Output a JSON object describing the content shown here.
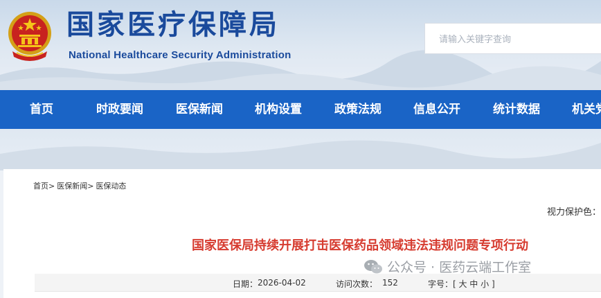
{
  "site": {
    "name_cn": "国家医疗保障局",
    "name_en": "National Healthcare Security Administration",
    "emblem_icon": "national-emblem-icon"
  },
  "search": {
    "placeholder": "请输入关键字查询"
  },
  "nav": {
    "items": [
      {
        "label": "首页"
      },
      {
        "label": "时政要闻"
      },
      {
        "label": "医保新闻"
      },
      {
        "label": "机构设置"
      },
      {
        "label": "政策法规"
      },
      {
        "label": "信息公开"
      },
      {
        "label": "统计数据"
      },
      {
        "label": "机关党"
      }
    ]
  },
  "breadcrumb": {
    "items": [
      "首页>",
      "医保新闻>",
      "医保动态"
    ]
  },
  "eyecare": {
    "label": "视力保护色："
  },
  "article": {
    "title": "国家医保局持续开展打击医保药品领域违法违规问题专项行动",
    "date_label": "日期：",
    "date": "2026-04-02",
    "views_label": "访问次数：",
    "views": "152",
    "font_label": "字号：[ 大 中 小 ]"
  },
  "watermark": {
    "text": "公众号 · 医药云端工作室"
  },
  "colors": {
    "brand_blue": "#1a64c6",
    "logo_blue": "#1a4a9c",
    "title_red": "#d63b2f"
  }
}
